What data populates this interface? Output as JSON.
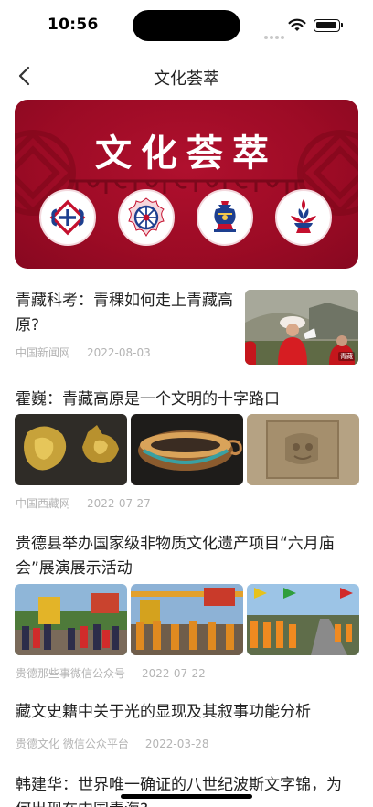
{
  "status": {
    "time": "10:56"
  },
  "nav": {
    "title": "文化荟萃"
  },
  "banner": {
    "title": "文化荟萃"
  },
  "articles": [
    {
      "title": "青藏科考：青稞如何走上青藏高原?",
      "source": "中国新闻网",
      "date": "2022-08-03",
      "thumb_badge": "青藏"
    },
    {
      "title": "霍巍：青藏高原是一个文明的十字路口",
      "source": "中国西藏网",
      "date": "2022-07-27"
    },
    {
      "title": "贵德县举办国家级非物质文化遗产项目“六月庙会”展演展示活动",
      "source": "贵德那些事微信公众号",
      "date": "2022-07-22"
    },
    {
      "title": "藏文史籍中关于光的显现及其叙事功能分析",
      "source": "贵德文化 微信公众平台",
      "date": "2022-03-28"
    },
    {
      "title": "韩建华：世界唯一确证的八世纪波斯文字锦，为何出现在中国青海?"
    }
  ],
  "colors": {
    "banner_red": "#9c0b25",
    "meta_gray": "#b4b4b4",
    "text": "#222222"
  }
}
